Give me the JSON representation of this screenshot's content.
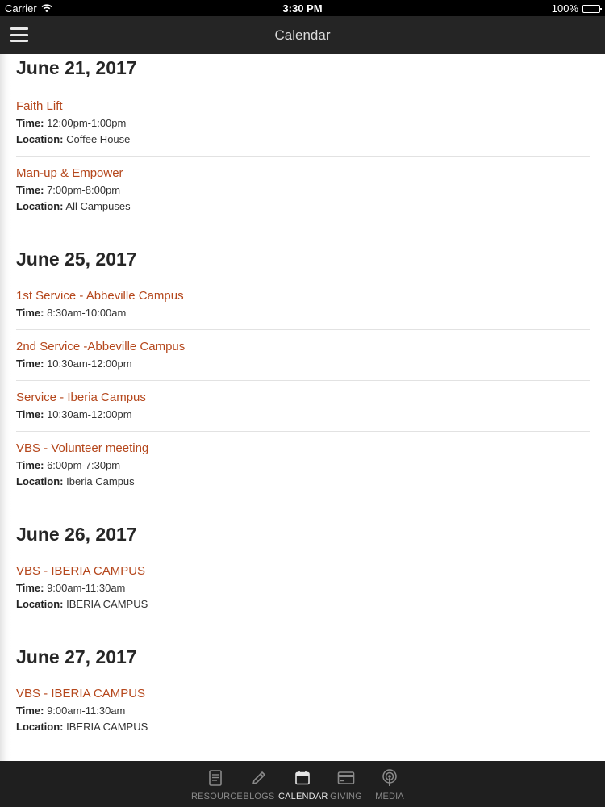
{
  "status_bar": {
    "carrier": "Carrier",
    "time": "3:30 PM",
    "battery_text": "100%",
    "battery_level": 1.0
  },
  "nav": {
    "title": "Calendar",
    "menu_icon": "hamburger-icon"
  },
  "days": [
    {
      "date": "June 21, 2017",
      "events": [
        {
          "title": "Faith Lift",
          "time": "12:00pm-1:00pm",
          "location": "Coffee House"
        },
        {
          "title": "Man-up & Empower",
          "time": "7:00pm-8:00pm",
          "location": "All Campuses"
        }
      ]
    },
    {
      "date": "June 25, 2017",
      "events": [
        {
          "title": "1st Service - Abbeville Campus",
          "time": "8:30am-10:00am"
        },
        {
          "title": "2nd Service -Abbeville Campus",
          "time": "10:30am-12:00pm"
        },
        {
          "title": "Service - Iberia Campus",
          "time": "10:30am-12:00pm"
        },
        {
          "title": "VBS - Volunteer meeting",
          "time": "6:00pm-7:30pm",
          "location": "Iberia Campus"
        }
      ]
    },
    {
      "date": "June 26, 2017",
      "events": [
        {
          "title": "VBS - IBERIA CAMPUS",
          "time": "9:00am-11:30am",
          "location": "IBERIA CAMPUS"
        }
      ]
    },
    {
      "date": "June 27, 2017",
      "events": [
        {
          "title": "VBS - IBERIA CAMPUS",
          "time": "9:00am-11:30am",
          "location": "IBERIA CAMPUS"
        }
      ]
    }
  ],
  "labels": {
    "time": "Time:",
    "location": "Location:"
  },
  "tabs": [
    {
      "label": "RESOURCE",
      "icon": "resource-icon",
      "active": false
    },
    {
      "label": "BLOGS",
      "icon": "pencil-icon",
      "active": false
    },
    {
      "label": "CALENDAR",
      "icon": "calendar-icon",
      "active": true
    },
    {
      "label": "GIVING",
      "icon": "credit-card-icon",
      "active": false
    },
    {
      "label": "MEDIA",
      "icon": "podcast-icon",
      "active": false
    }
  ],
  "colors": {
    "event_title": "#b5471c",
    "nav_background": "#252525",
    "tab_background": "#1f1f1f"
  }
}
